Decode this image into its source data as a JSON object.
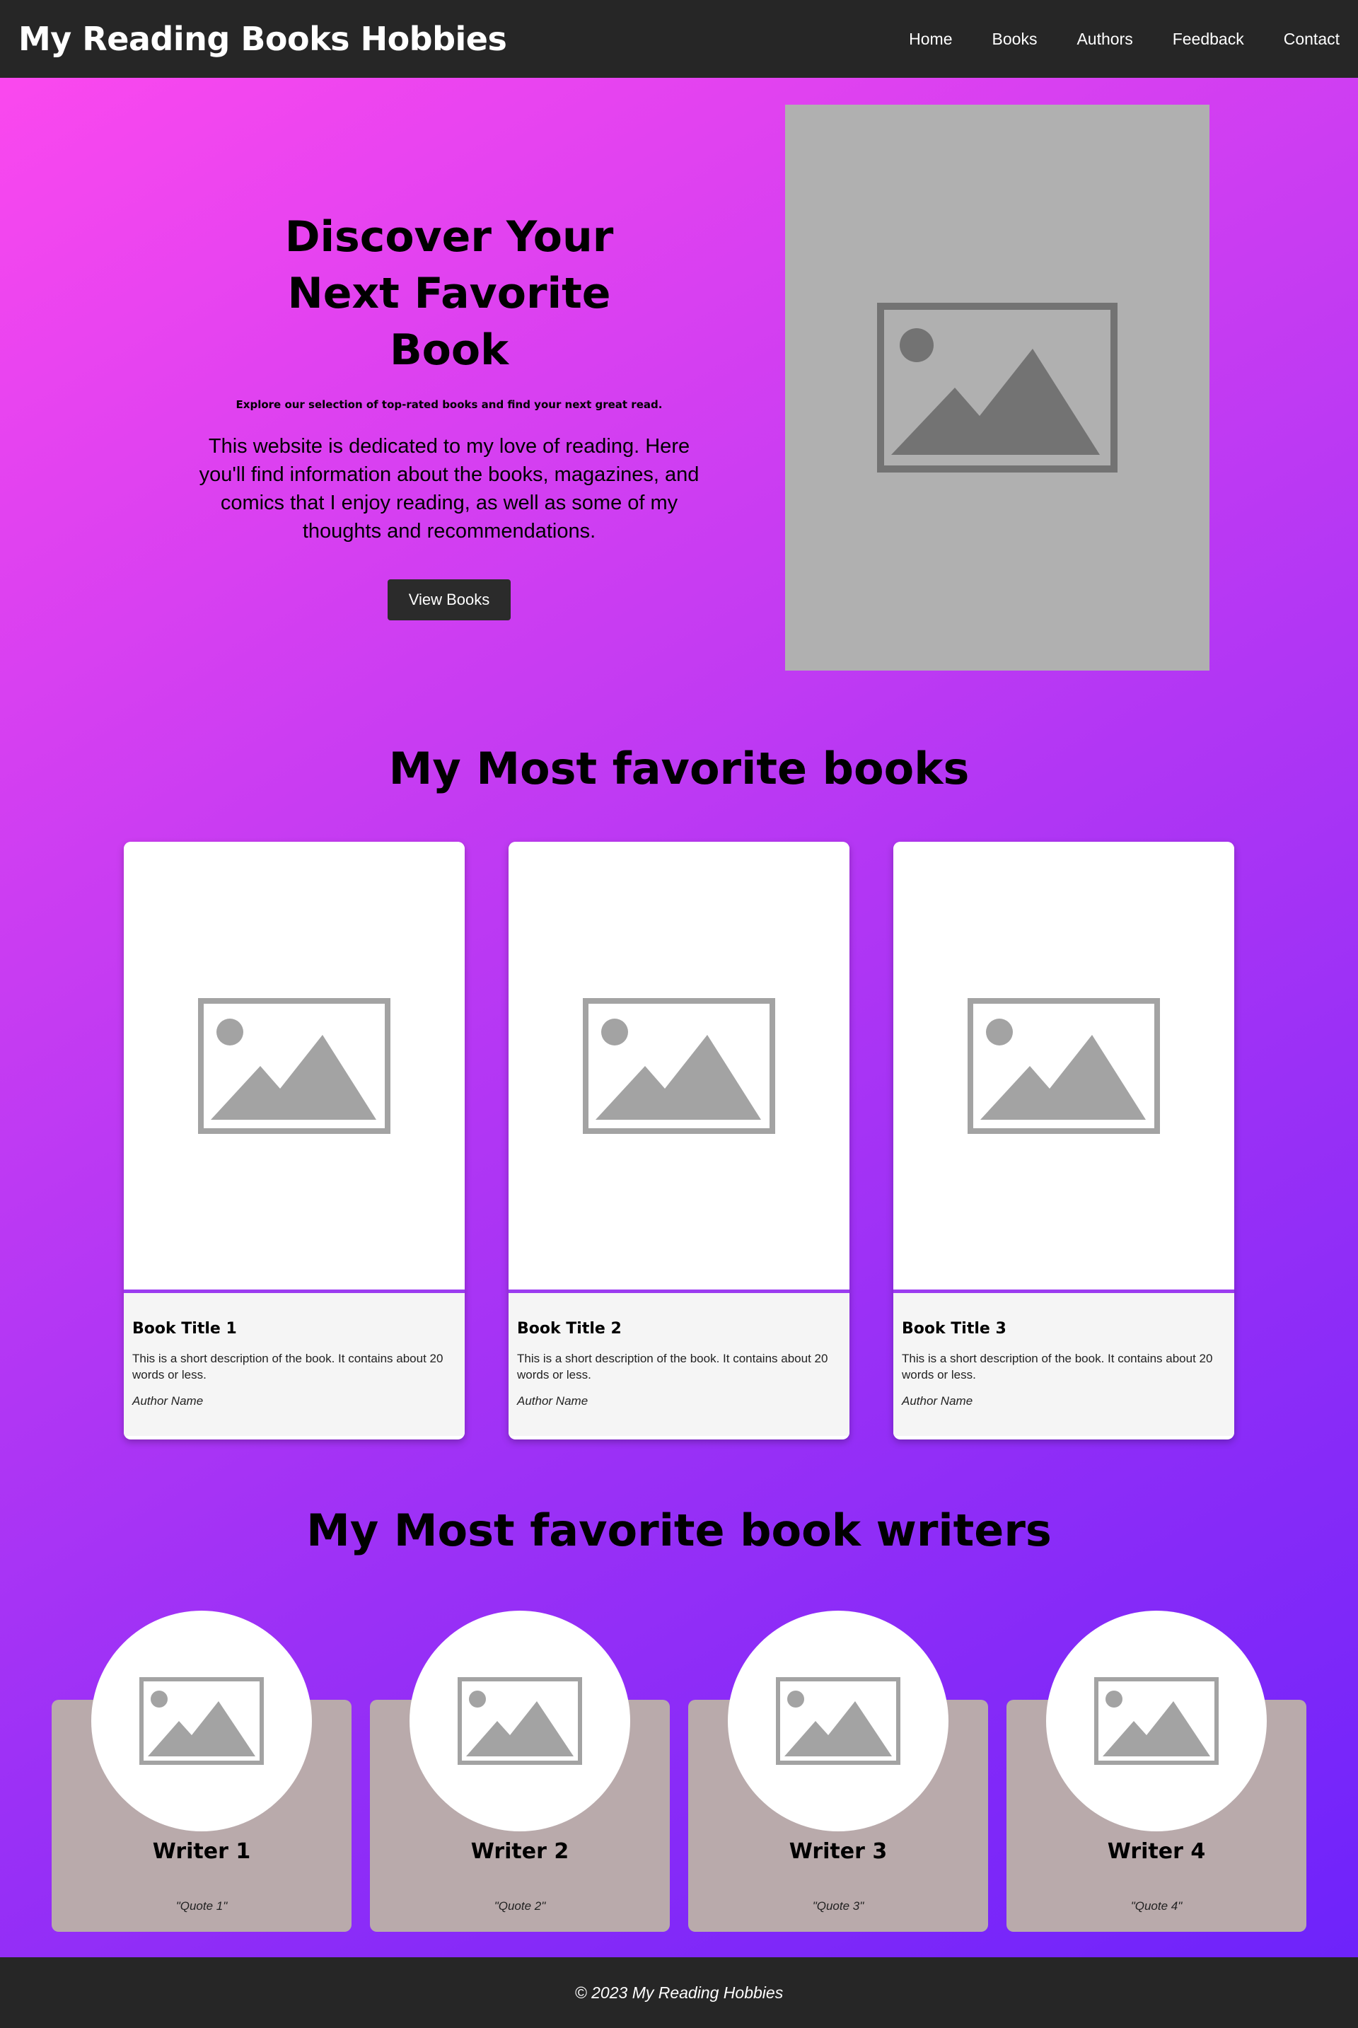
{
  "header": {
    "brand": "My Reading Books Hobbies",
    "nav": [
      "Home",
      "Books",
      "Authors",
      "Feedback",
      "Contact"
    ]
  },
  "hero": {
    "title": "Discover Your Next Favorite Book",
    "tagline": "Explore our selection of top-rated books and find your next great read.",
    "description": "This website is dedicated to my love of reading. Here you'll find information about the books, magazines, and comics that I enjoy reading, as well as some of my thoughts and recommendations.",
    "button": "View Books",
    "image_icon": "image-placeholder-icon"
  },
  "books_section": {
    "title": "My Most favorite books",
    "books": [
      {
        "title": "Book Title 1",
        "description": "This is a short description of the book. It contains about 20 words or less.",
        "author": "Author Name"
      },
      {
        "title": "Book Title 2",
        "description": "This is a short description of the book. It contains about 20 words or less.",
        "author": "Author Name"
      },
      {
        "title": "Book Title 3",
        "description": "This is a short description of the book. It contains about 20 words or less.",
        "author": "Author Name"
      }
    ]
  },
  "writers_section": {
    "title": "My Most favorite book writers",
    "writers": [
      {
        "name": "Writer 1",
        "quote": "\"Quote 1\""
      },
      {
        "name": "Writer 2",
        "quote": "\"Quote 2\""
      },
      {
        "name": "Writer 3",
        "quote": "\"Quote 3\""
      },
      {
        "name": "Writer 4",
        "quote": "\"Quote 4\""
      }
    ]
  },
  "footer": {
    "text": "© 2023 My Reading Hobbies"
  },
  "colors": {
    "header_bg": "#262626",
    "gradient_start": "#ff49ee",
    "gradient_end": "#6a22fb",
    "writer_card_bg": "#b9aaab",
    "card_accent": "#9b3cf0"
  }
}
